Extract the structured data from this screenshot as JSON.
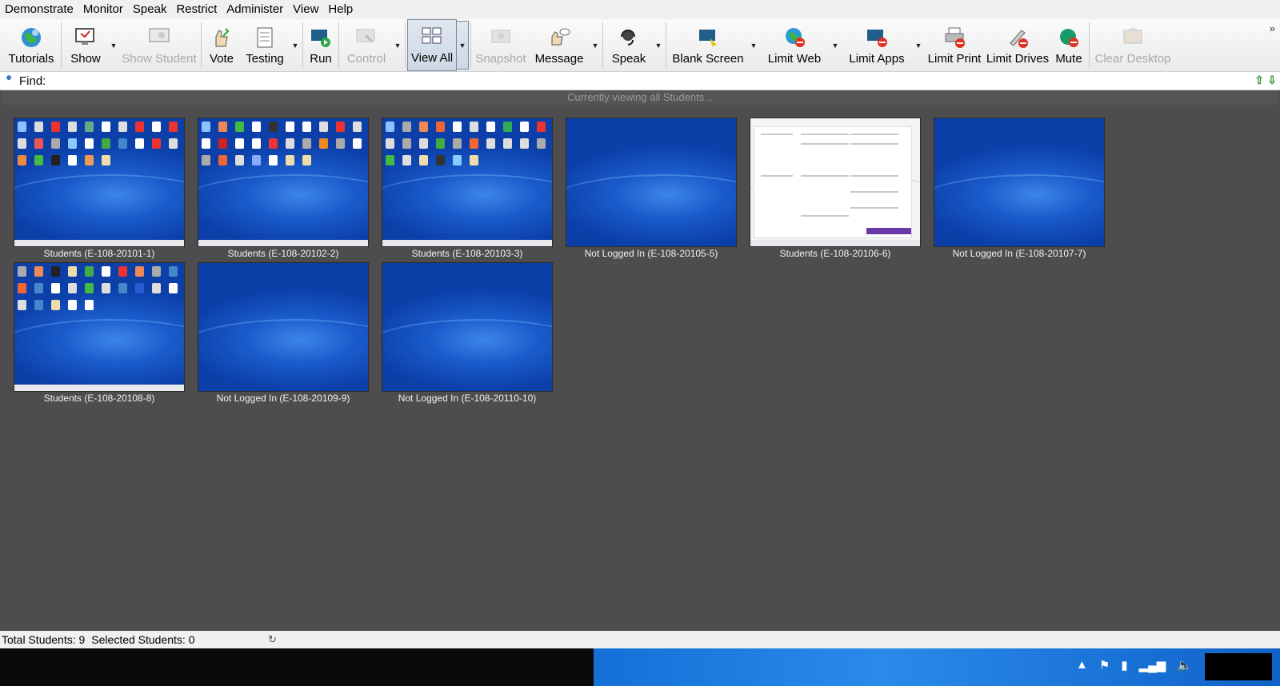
{
  "menu": [
    "Demonstrate",
    "Monitor",
    "Speak",
    "Restrict",
    "Administer",
    "View",
    "Help"
  ],
  "toolbar": {
    "tutorials": "Tutorials",
    "show": "Show",
    "show_student": "Show Student",
    "vote": "Vote",
    "testing": "Testing",
    "run": "Run",
    "control": "Control",
    "view_all": "View All",
    "snapshot": "Snapshot",
    "message": "Message",
    "speak": "Speak",
    "blank_screen": "Blank Screen",
    "limit_web": "Limit Web",
    "limit_apps": "Limit Apps",
    "limit_print": "Limit Print",
    "limit_drives": "Limit Drives",
    "mute": "Mute",
    "clear_desktop": "Clear Desktop"
  },
  "find": {
    "label": "Find:",
    "value": ""
  },
  "view_status": "Currently viewing all Students...",
  "thumbnails": [
    {
      "caption": "Students (E-108-20101-1)",
      "state": "desktop"
    },
    {
      "caption": "Students (E-108-20102-2)",
      "state": "desktop"
    },
    {
      "caption": "Students (E-108-20103-3)",
      "state": "desktop"
    },
    {
      "caption": "Not Logged In (E-108-20105-5)",
      "state": "login"
    },
    {
      "caption": "Students (E-108-20106-6)",
      "state": "document"
    },
    {
      "caption": "Not Logged In (E-108-20107-7)",
      "state": "login"
    },
    {
      "caption": "Students (E-108-20108-8)",
      "state": "desktop"
    },
    {
      "caption": "Not Logged In (E-108-20109-9)",
      "state": "login"
    },
    {
      "caption": "Not Logged In (E-108-20110-10)",
      "state": "login"
    }
  ],
  "status": {
    "total": "Total Students: 9",
    "selected": "Selected Students: 0"
  },
  "colors": {
    "desktop_blue": "#1a5ccc",
    "view_bg": "#4d4d4d",
    "toolbar_bg": "#f0f0f0"
  }
}
